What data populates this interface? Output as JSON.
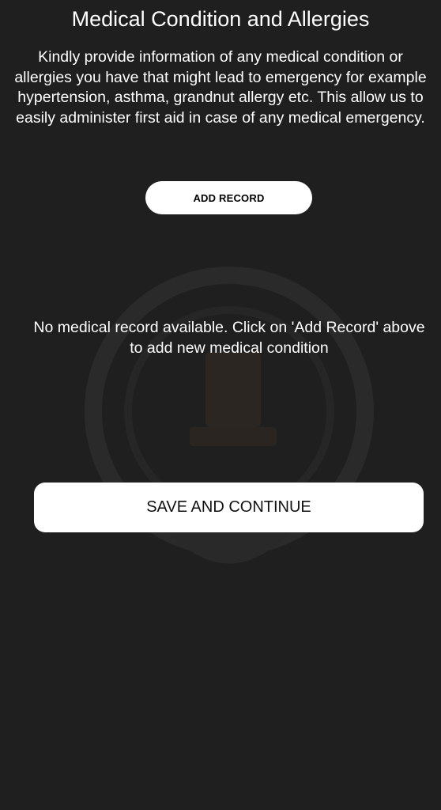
{
  "header": {
    "title": "Medical Condition and Allergies"
  },
  "intro": {
    "description": "Kindly provide information of any medical condition or allergies you have that might lead to emergency for example hypertension, asthma, grandnut allergy etc. This allow us to easily administer first aid in case of any medical emergency."
  },
  "actions": {
    "add_record_label": "ADD RECORD",
    "save_label": "SAVE AND CONTINUE"
  },
  "records": {
    "empty_message": "No medical record available. Click on 'Add Record' above to add new medical condition"
  },
  "colors": {
    "background": "#1f1f1f",
    "button_bg": "#ffffff",
    "text": "#ffffff"
  },
  "icons": {
    "watermark": "emblem-watermark-icon"
  }
}
